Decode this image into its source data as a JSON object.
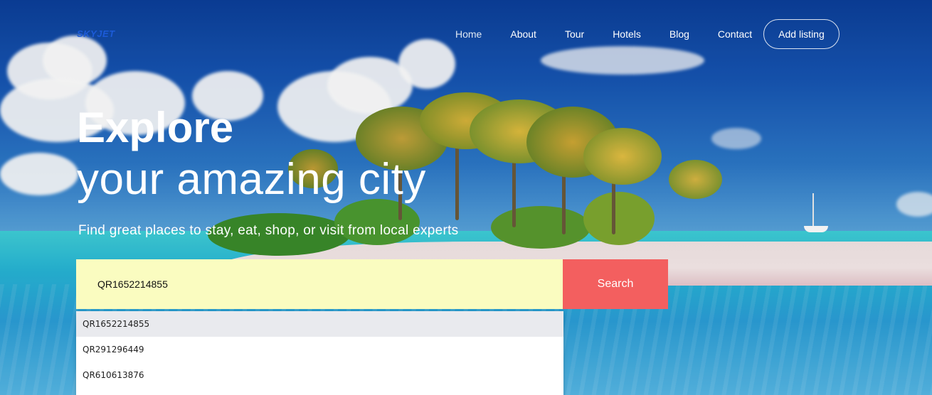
{
  "brand": {
    "logo_text": "SKYJET"
  },
  "nav": {
    "items": [
      {
        "label": "Home",
        "active": true
      },
      {
        "label": "About"
      },
      {
        "label": "Tour"
      },
      {
        "label": "Hotels"
      },
      {
        "label": "Blog"
      },
      {
        "label": "Contact"
      }
    ],
    "cta_label": "Add listing"
  },
  "hero": {
    "title_bold": "Explore",
    "title_light": "your amazing city",
    "subtitle": "Find great places to stay, eat, shop, or visit from local experts"
  },
  "search": {
    "value": "QR1652214855",
    "button_label": "Search",
    "suggestions": [
      "QR1652214855",
      "QR291296449",
      "QR610613876"
    ]
  },
  "colors": {
    "search_field_bg": "#fafcc0",
    "search_button_bg": "#f35f5f",
    "highlight_row": "#e9eaee"
  }
}
